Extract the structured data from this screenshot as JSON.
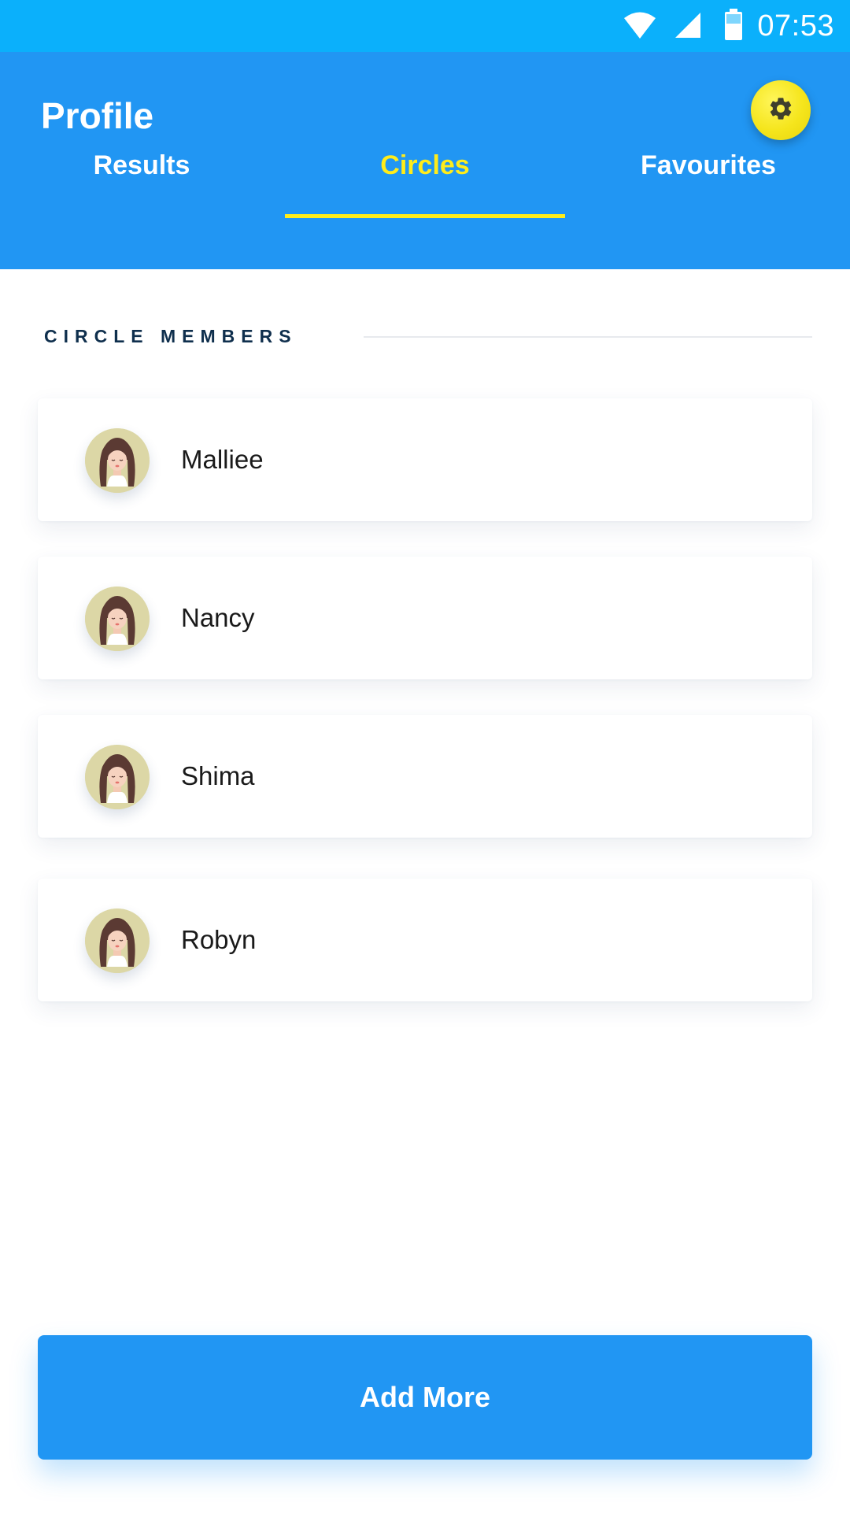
{
  "status_bar": {
    "time": "07:53",
    "icons": [
      "wifi-icon",
      "signal-icon",
      "battery-icon"
    ]
  },
  "header": {
    "title": "Profile",
    "settings_icon": "gear-icon"
  },
  "tabs": [
    {
      "label": "Results",
      "active": false
    },
    {
      "label": "Circles",
      "active": true
    },
    {
      "label": "Favourites",
      "active": false
    }
  ],
  "section": {
    "label": "CIRCLE MEMBERS"
  },
  "members": [
    {
      "name": "Malliee",
      "avatar_icon": "girl-avatar-icon"
    },
    {
      "name": "Nancy",
      "avatar_icon": "girl-avatar-icon"
    },
    {
      "name": "Shima",
      "avatar_icon": "girl-avatar-icon"
    },
    {
      "name": "Robyn",
      "avatar_icon": "girl-avatar-icon"
    }
  ],
  "actions": {
    "add_more_label": "Add More"
  },
  "colors": {
    "status_bar": "#0bb0fb",
    "header": "#2196f3",
    "active_tab": "#ffec1a",
    "settings_button": "#f5e51c",
    "section_label": "#0f2f4d",
    "button": "#2196f3"
  }
}
